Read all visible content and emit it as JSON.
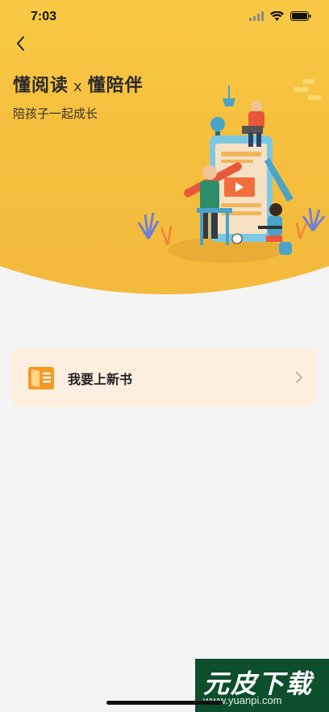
{
  "status_bar": {
    "time": "7:03"
  },
  "header": {
    "title_left": "懂阅读",
    "title_sep": "x",
    "title_right": "懂陪伴",
    "subtitle": "陪孩子一起成长"
  },
  "menu": {
    "items": [
      {
        "label": "我要上新书",
        "icon": "open-book-icon"
      }
    ]
  },
  "watermark": {
    "main": "元皮下载",
    "sub": "www.yuanpi.com"
  },
  "colors": {
    "hero": "#f6c03e",
    "card_bg": "#fdefe0",
    "icon_orange": "#f59a23",
    "page_bg": "#f4f4f4"
  }
}
